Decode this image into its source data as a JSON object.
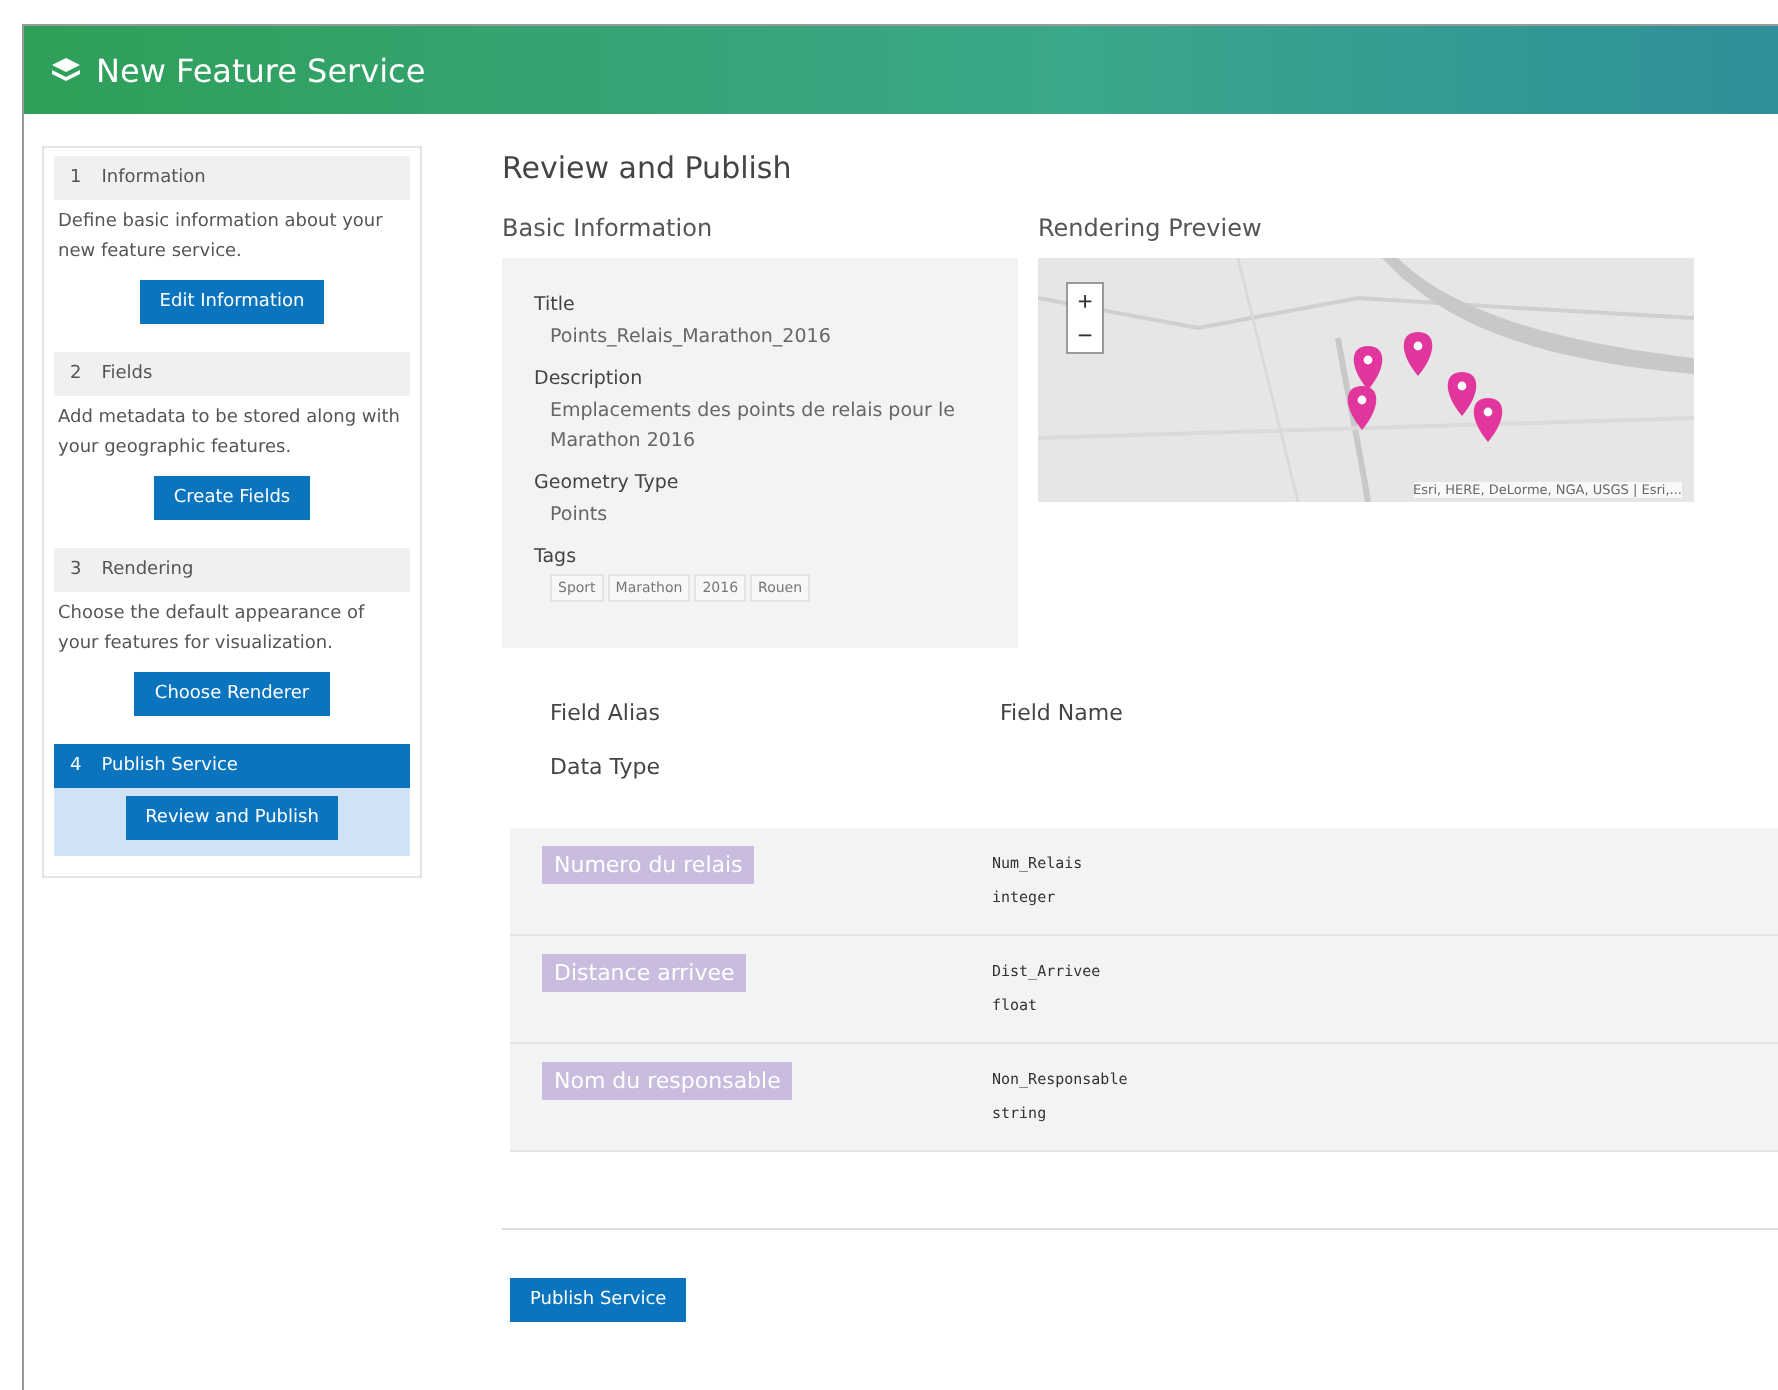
{
  "window": {
    "title": "New Feature Service"
  },
  "steps": [
    {
      "number": "1",
      "title": "Information",
      "description": "Define basic information about your new feature service.",
      "button": "Edit Information",
      "selected": false
    },
    {
      "number": "2",
      "title": "Fields",
      "description": "Add metadata to be stored along with your geographic features.",
      "button": "Create Fields",
      "selected": false
    },
    {
      "number": "3",
      "title": "Rendering",
      "description": "Choose the default appearance of your features for visualization.",
      "button": "Choose Renderer",
      "selected": false
    },
    {
      "number": "4",
      "title": "Publish Service",
      "button": "Review and Publish",
      "selected": true
    }
  ],
  "page_title": "Review and Publish",
  "basic_information": {
    "heading": "Basic Information",
    "items": [
      {
        "label": "Title",
        "value": "Points_Relais_Marathon_2016"
      },
      {
        "label": "Description",
        "value": "Emplacements des points de relais pour le Marathon 2016"
      },
      {
        "label": "Geometry Type",
        "value": "Points"
      }
    ],
    "tags_label": "Tags",
    "tags": [
      "Sport",
      "Marathon",
      "2016",
      "Rouen"
    ]
  },
  "rendering_preview": {
    "heading": "Rendering Preview",
    "zoom_in": "+",
    "zoom_out": "−",
    "attribution": "Esri, HERE, DeLorme, NGA, USGS | Esri,..."
  },
  "fields": {
    "headers": [
      "Field Alias",
      "Field Name",
      "Data Type"
    ],
    "rows": [
      {
        "alias": "Numero du relais",
        "name": "Num_Relais",
        "type": "integer"
      },
      {
        "alias": "Distance arrivee",
        "name": "Dist_Arrivee",
        "type": "float"
      },
      {
        "alias": "Nom du responsable",
        "name": "Non_Responsable",
        "type": "string"
      }
    ]
  },
  "publish_button": "Publish Service"
}
